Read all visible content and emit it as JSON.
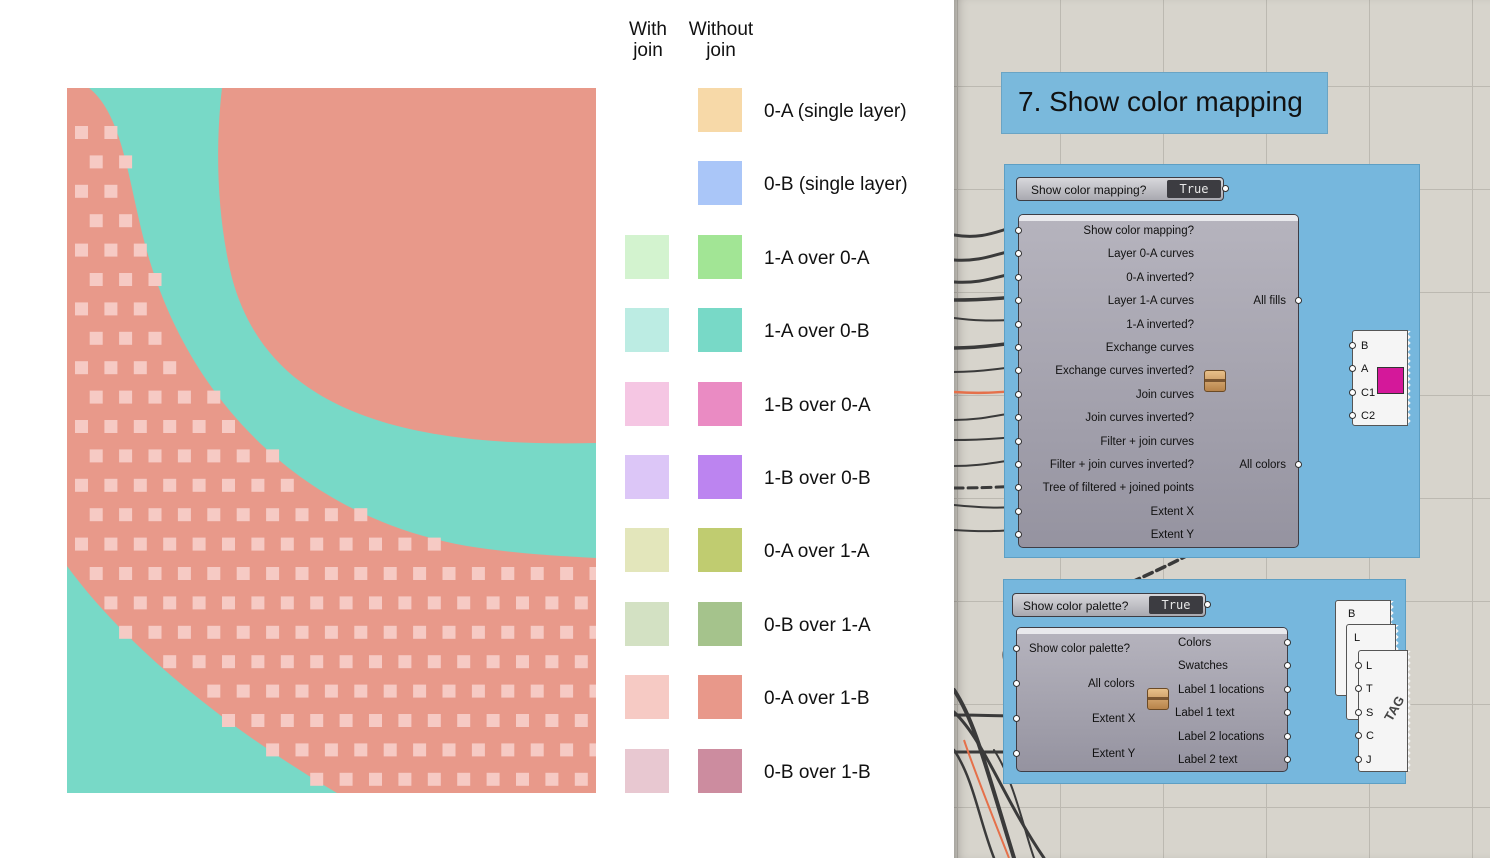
{
  "legend": {
    "header_with": "With\njoin",
    "header_without": "Without\njoin",
    "entries": [
      {
        "label": "0-A (single layer)",
        "with": null,
        "without": "#f7d9a8"
      },
      {
        "label": "0-B (single layer)",
        "with": null,
        "without": "#aac6f8"
      },
      {
        "label": "1-A over 0-A",
        "with": "#d3f3cf",
        "without": "#a2e595"
      },
      {
        "label": "1-A over 0-B",
        "with": "#bcece3",
        "without": "#78d9c7"
      },
      {
        "label": "1-B over 0-A",
        "with": "#f5c6e3",
        "without": "#ea8bc3"
      },
      {
        "label": "1-B over 0-B",
        "with": "#dcc6f7",
        "without": "#bc84f0"
      },
      {
        "label": "0-A over 1-A",
        "with": "#e3e6bb",
        "without": "#c0cc70"
      },
      {
        "label": "0-B over 1-A",
        "with": "#d3e1c3",
        "without": "#a5c38c"
      },
      {
        "label": "0-A over 1-B",
        "with": "#f6cac4",
        "without": "#e8988a"
      },
      {
        "label": "0-B over 1-B",
        "with": "#e8c8d1",
        "without": "#cc8c9f"
      }
    ]
  },
  "artwork": {
    "color_teal": "#78d9c7",
    "color_salmon": "#e8998a",
    "color_dots": "#f6cac4"
  },
  "canvas": {
    "group_title": "7. Show color mapping",
    "toggle1": {
      "label": "Show color mapping?",
      "value": "True"
    },
    "comp1": {
      "inputs": [
        "Show color mapping?",
        "Layer 0-A curves",
        "0-A inverted?",
        "Layer 1-A curves",
        "1-A inverted?",
        "Exchange curves",
        "Exchange curves inverted?",
        "Join curves",
        "Join curves inverted?",
        "Filter + join curves",
        "Filter + join curves inverted?",
        "Tree of filtered + joined points",
        "Extent X",
        "Extent Y"
      ],
      "outputs": [
        "All fills",
        "All colors"
      ]
    },
    "swatch_panel": {
      "pins": [
        "B",
        "A",
        "C1",
        "C2"
      ],
      "color": "#d4189a"
    },
    "toggle2": {
      "label": "Show color palette?",
      "value": "True"
    },
    "comp2": {
      "inputs": [
        "Show color palette?",
        "All colors",
        "Extent X",
        "Extent Y"
      ],
      "outputs": [
        "Colors",
        "Swatches",
        "Label 1 locations",
        "Label 1 text",
        "Label 2 locations",
        "Label 2 text"
      ]
    },
    "panel_b": {
      "label": "B"
    },
    "panel_l": {
      "label": "L"
    },
    "tag_panel": {
      "pins": [
        "L",
        "T",
        "S",
        "C",
        "J"
      ],
      "tag": "TAG"
    }
  }
}
